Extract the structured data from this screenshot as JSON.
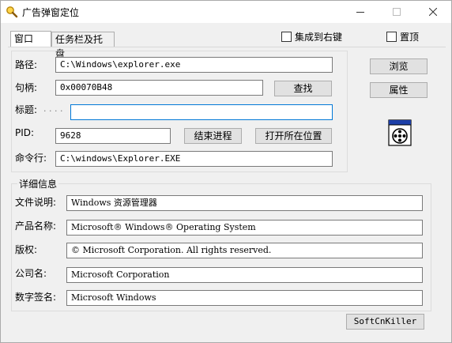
{
  "window": {
    "title": "广告弹窗定位"
  },
  "tabs": [
    "窗口",
    "任务栏及托盘"
  ],
  "options": {
    "tray_label": "集成到右键",
    "topmost_label": "置顶"
  },
  "window_info": {
    "path_label": "路径:",
    "path_value": "C:\\Windows\\explorer.exe",
    "handle_label": "句柄:",
    "handle_value": "0x00070B48",
    "find_button": "查找",
    "title_label": "标题:",
    "title_value": "",
    "pid_label": "PID:",
    "pid_value": "9628",
    "end_process_button": "结束进程",
    "open_location_button": "打开所在位置",
    "cmdline_label": "命令行:",
    "cmdline_value": "C:\\windows\\Explorer.EXE"
  },
  "side": {
    "browse_button": "浏览",
    "properties_button": "属性"
  },
  "details": {
    "legend": "详细信息",
    "desc_label": "文件说明:",
    "desc_value": "Windows 资源管理器",
    "product_label": "产品名称:",
    "product_value": "Microsoft® Windows® Operating System",
    "copyright_label": "版权:",
    "copyright_value": "© Microsoft Corporation. All rights reserved.",
    "company_label": "公司名:",
    "company_value": "Microsoft Corporation",
    "signature_label": "数字签名:",
    "signature_value": "Microsoft Windows"
  },
  "footer": {
    "softcnkiller_button": "SoftCnKiller"
  }
}
